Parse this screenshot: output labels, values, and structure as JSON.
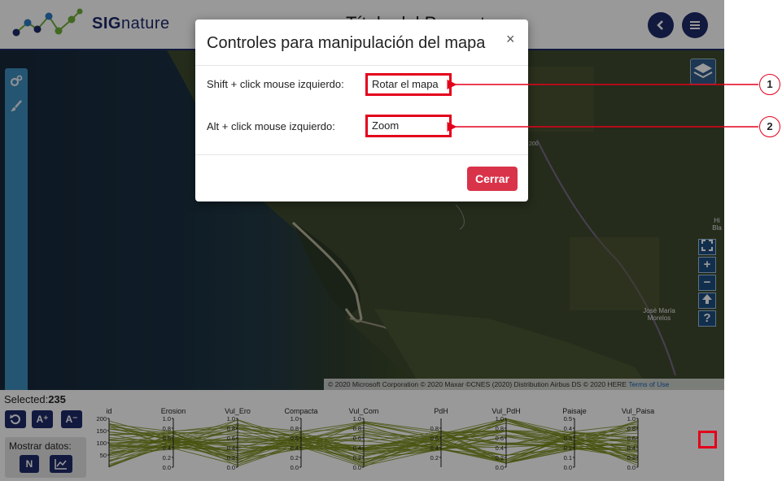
{
  "header": {
    "brand_bold": "SIG",
    "brand_rest": "nature",
    "project_title": "Título del Proyecto",
    "back_icon": "chevron-left-icon",
    "menu_icon": "hamburger-menu-icon",
    "brand_color": "#1e2a6a"
  },
  "map": {
    "attribution": "© 2020 Microsoft Corporation © 2020 Maxar ©CNES (2020) Distribution Airbus DS © 2020 HERE",
    "terms_link": "Terms of Use",
    "road_label": "200",
    "town_label": "José María Morelos",
    "town_partial": "Hi Bla"
  },
  "left_toolbar": {
    "icons": [
      "gears-icon",
      "brush-icon"
    ],
    "color": "#3c8ebf"
  },
  "bottom_panel": {
    "selected_label": "Selected:",
    "selected_count": "235",
    "show_data_label": "Mostrar datos:",
    "numeric_button": "N",
    "font_up": "A⁺",
    "font_down": "A⁻",
    "parallel_axes": [
      "id",
      "Erosion",
      "Vul_Ero",
      "Compacta",
      "Vul_Com",
      "PdH",
      "Vul_PdH",
      "Paisaje",
      "Vul_Paisa"
    ],
    "id_ticks": [
      "200",
      "150",
      "100",
      "50"
    ],
    "unit_ticks": [
      "1.0",
      "0.8",
      "0.6",
      "0.4",
      "0.2",
      "0.0"
    ],
    "paisaje_ticks": [
      "0.5",
      "0.4",
      "0.3",
      "0.2",
      "0.1",
      "0.0"
    ],
    "pdh_ticks": [
      "0.8",
      "0.6",
      "0.4",
      "0.2"
    ],
    "line_color": "#7a8c1c"
  },
  "modal": {
    "title": "Controles para manipulación del mapa",
    "close_glyph": "×",
    "rows": [
      {
        "label": "Shift + click mouse izquierdo:",
        "value": "Rotar el mapa"
      },
      {
        "label": "Alt + click mouse izquierdo:",
        "value": "Zoom"
      }
    ],
    "close_button": "Cerrar",
    "close_button_color": "#d9334a"
  },
  "annotations": {
    "callouts": [
      "1",
      "2"
    ],
    "color": "#e3001b"
  }
}
